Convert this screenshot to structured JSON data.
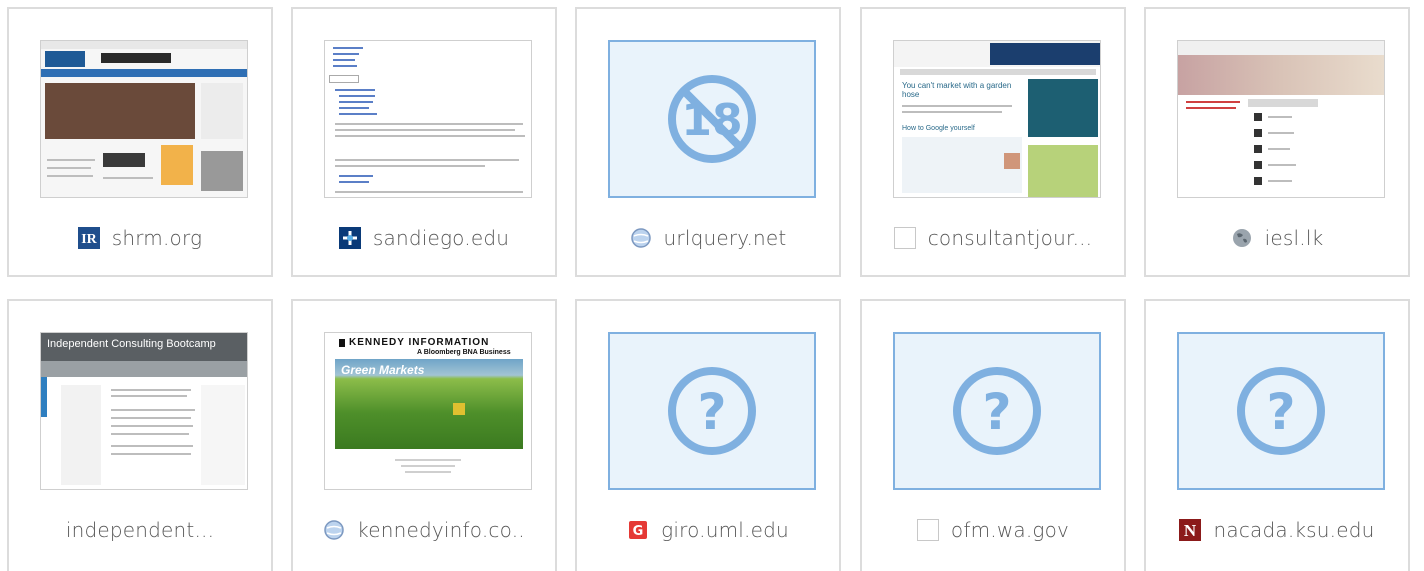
{
  "tiles": [
    {
      "label": "shrm.org",
      "thumb": "shot-shrm",
      "favicon": "shrm-logo-icon"
    },
    {
      "label": "sandiego.edu",
      "thumb": "shot-sandiego",
      "favicon": "sandiego-logo-icon"
    },
    {
      "label": "urlquery.net",
      "thumb": "placeholder-18",
      "favicon": "globe-icon"
    },
    {
      "label": "consultantjour...",
      "thumb": "shot-consultant",
      "favicon": "blank-favicon-icon"
    },
    {
      "label": "iesl.lk",
      "thumb": "shot-iesl",
      "favicon": "globe-icon"
    },
    {
      "label": "independent...",
      "thumb": "shot-independent",
      "favicon": "none"
    },
    {
      "label": "kennedyinfo.co..",
      "thumb": "shot-kennedy",
      "favicon": "globe-icon"
    },
    {
      "label": "giro.uml.edu",
      "thumb": "placeholder-question",
      "favicon": "giro-logo-icon"
    },
    {
      "label": "ofm.wa.gov",
      "thumb": "placeholder-question",
      "favicon": "blank-favicon-icon"
    },
    {
      "label": "nacada.ksu.edu",
      "thumb": "placeholder-question",
      "favicon": "nacada-logo-icon"
    }
  ],
  "thumb_text": {
    "age_badge": "18",
    "kennedy_title": "KENNEDY INFORMATION",
    "kennedy_subtitle": "A Bloomberg BNA Business",
    "kennedy_green": "Green Markets",
    "independent_title": "Independent Consulting Bootcamp",
    "consultant_heading1": "You can't market with a garden hose",
    "consultant_heading2": "How to Google yourself"
  },
  "colors": {
    "placeholder_bg": "#e9f3fb",
    "placeholder_border": "#7fb0e0",
    "placeholder_glyph": "#7fb0e0",
    "tile_border": "#dcdcdc",
    "label_text": "#555555"
  }
}
